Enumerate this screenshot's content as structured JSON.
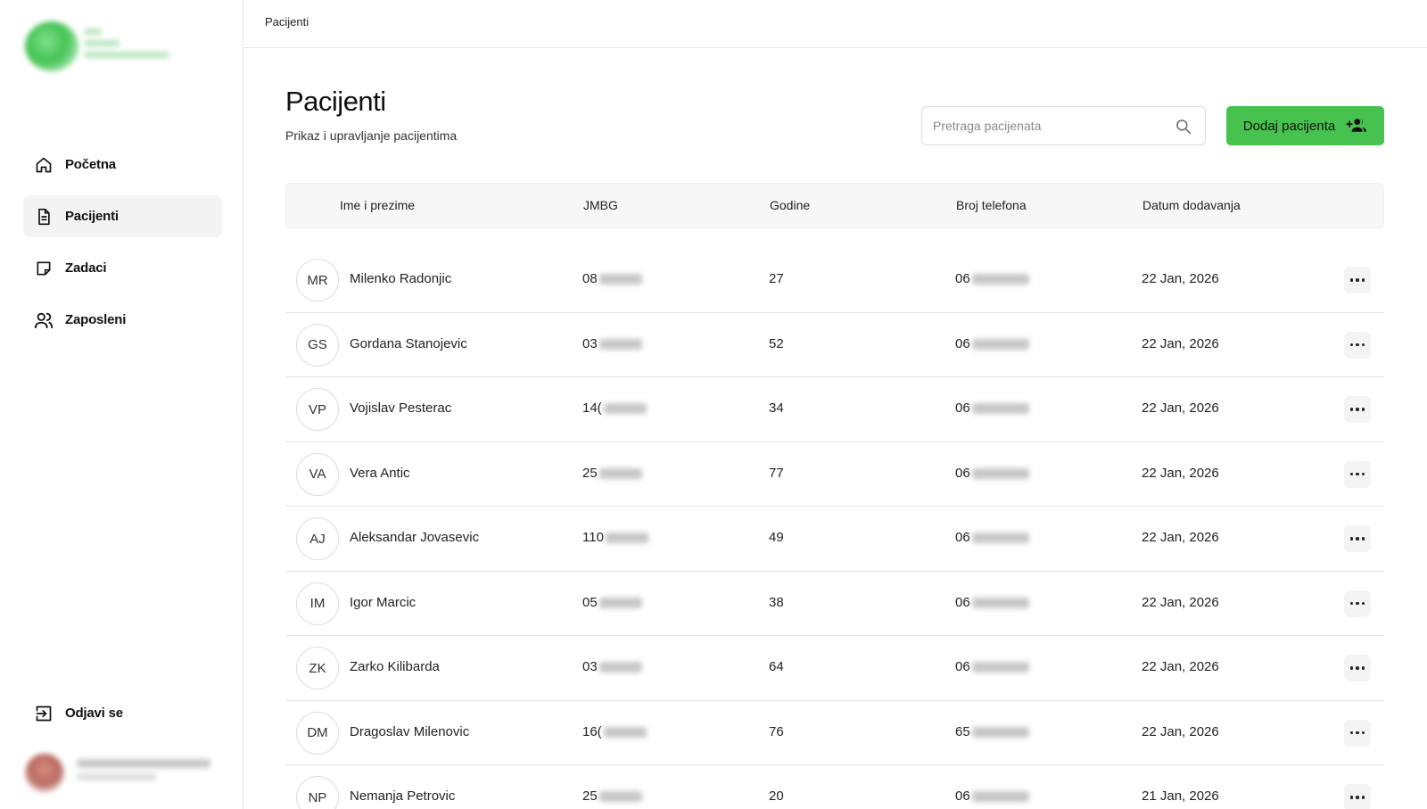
{
  "sidebar": {
    "nav": [
      {
        "label": "Početna",
        "icon": "home-icon"
      },
      {
        "label": "Pacijenti",
        "icon": "document-icon",
        "active": true
      },
      {
        "label": "Zadaci",
        "icon": "sticky-note-icon"
      },
      {
        "label": "Zaposleni",
        "icon": "users-icon"
      }
    ],
    "logout_label": "Odjavi se",
    "logout_icon": "logout-icon"
  },
  "topbar": {
    "breadcrumb": "Pacijenti"
  },
  "header": {
    "title": "Pacijenti",
    "subtitle": "Prikaz i upravljanje pacijentima",
    "search_placeholder": "Pretraga pacijenata",
    "add_button_label": "Dodaj pacijenta",
    "accent_color": "#47c24f"
  },
  "table": {
    "columns": [
      "Ime i prezime",
      "JMBG",
      "Godine",
      "Broj telefona",
      "Datum dodavanja"
    ],
    "rows": [
      {
        "initials": "MR",
        "name": "Milenko Radonjic",
        "jmbg": "08",
        "age": "27",
        "phone": "06",
        "date": "22 Jan, 2026"
      },
      {
        "initials": "GS",
        "name": "Gordana Stanojevic",
        "jmbg": "03",
        "age": "52",
        "phone": "06",
        "date": "22 Jan, 2026"
      },
      {
        "initials": "VP",
        "name": "Vojislav Pesterac",
        "jmbg": "14(",
        "age": "34",
        "phone": "06",
        "date": "22 Jan, 2026"
      },
      {
        "initials": "VA",
        "name": "Vera Antic",
        "jmbg": "25",
        "age": "77",
        "phone": "06",
        "date": "22 Jan, 2026"
      },
      {
        "initials": "AJ",
        "name": "Aleksandar Jovasevic",
        "jmbg": "110",
        "age": "49",
        "phone": "06",
        "date": "22 Jan, 2026"
      },
      {
        "initials": "IM",
        "name": "Igor Marcic",
        "jmbg": "05",
        "age": "38",
        "phone": "06",
        "date": "22 Jan, 2026"
      },
      {
        "initials": "ZK",
        "name": "Zarko Kilibarda",
        "jmbg": "03",
        "age": "64",
        "phone": "06",
        "date": "22 Jan, 2026"
      },
      {
        "initials": "DM",
        "name": "Dragoslav Milenovic",
        "jmbg": "16(",
        "age": "76",
        "phone": "65",
        "date": "22 Jan, 2026"
      },
      {
        "initials": "NP",
        "name": "Nemanja Petrovic",
        "jmbg": "25",
        "age": "20",
        "phone": "06",
        "date": "21 Jan, 2026"
      }
    ]
  }
}
